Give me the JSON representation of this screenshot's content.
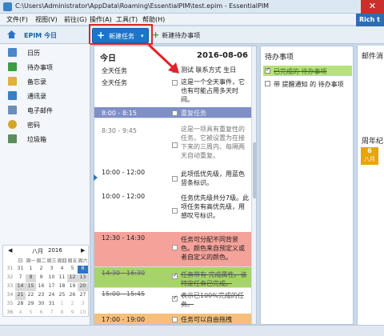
{
  "window": {
    "title": "C:\\Users\\Administrator\\AppData\\Roaming\\EssentialPIM\\test.epim - EssentialPIM",
    "close_symbol": "✕"
  },
  "menu": {
    "items": [
      "文件(F)",
      "视图(V)",
      "前往(G)",
      "操作(A)",
      "工具(T)",
      "帮助(H)"
    ],
    "rich_badge": "Rich t"
  },
  "toolbar": {
    "today_label": "EPIM 今日",
    "new_task_label": "新建任务",
    "new_task_plus": "+",
    "new_task_caret": "▾",
    "new_todo_label": "新建待办事项",
    "new_todo_plus": "+"
  },
  "sidebar": {
    "items": [
      {
        "label": "日历",
        "icon": "calendar-icon",
        "color": "#4a86c6"
      },
      {
        "label": "待办事项",
        "icon": "todo-icon",
        "color": "#3f9d3f"
      },
      {
        "label": "备忘录",
        "icon": "note-icon",
        "color": "#e0b23a"
      },
      {
        "label": "通讯录",
        "icon": "contacts-icon",
        "color": "#3b7fc3"
      },
      {
        "label": "电子邮件",
        "icon": "mail-icon",
        "color": "#6a8fb8"
      },
      {
        "label": "密码",
        "icon": "key-icon",
        "color": "#d4a52a"
      },
      {
        "label": "垃圾箱",
        "icon": "trash-icon",
        "color": "#5c8d5c"
      }
    ]
  },
  "minical": {
    "month": "八月",
    "year": "2016",
    "prev": "◀",
    "next": "▶",
    "weekdays": [
      "",
      "日",
      "周一",
      "周二",
      "周三",
      "周四",
      "周五",
      "周六"
    ],
    "weeks": [
      [
        "31",
        "31",
        "1",
        "2",
        "3",
        "4",
        "5",
        "6"
      ],
      [
        "32",
        "7",
        "8",
        "9",
        "10",
        "11",
        "12",
        "13"
      ],
      [
        "33",
        "14",
        "15",
        "16",
        "17",
        "18",
        "19",
        "20"
      ],
      [
        "34",
        "21",
        "22",
        "23",
        "24",
        "25",
        "26",
        "27"
      ],
      [
        "35",
        "28",
        "29",
        "30",
        "31",
        "1",
        "2",
        "3"
      ],
      [
        "36",
        "4",
        "5",
        "6",
        "7",
        "8",
        "9",
        "10"
      ]
    ]
  },
  "day_view": {
    "title": "今日",
    "date": "2016-08-06",
    "events": [
      {
        "time": "全天任务",
        "desc": "测试 联系方式 生日",
        "bg": "#ffffff",
        "checked": false
      },
      {
        "time": "全天任务",
        "desc": "这是一个全天事件，它也有可能占用多天时间。",
        "bg": "#ffffff",
        "checked": false
      },
      {
        "time": "8:00 - 8:15",
        "desc": "重复任务",
        "bg": "#7f8fc8",
        "checked": false
      },
      {
        "time": "8:30 - 9:45",
        "desc": "这是一项具有重复性的任务。它被设置为在接下来的三周内、每隔两天自动重复。",
        "bg": "#ffffff",
        "checked": false
      },
      {
        "time": "10:00 - 12:00",
        "desc": "此项低优先级，用蓝色竖条标识。",
        "bg": "#ffffff",
        "checked": false
      },
      {
        "time": "10:00 - 12:00",
        "desc": "任务优先级共分7级。此项任务有高优先级，用感叹号标识。",
        "bg": "#ffffff",
        "checked": false
      },
      {
        "time": "12:30 - 14:30",
        "desc": "任务可分配不同背景色。颜色来自预定义或者自定义的颜色。",
        "bg": "#f5a29a",
        "checked": false
      },
      {
        "time": "14:30 - 16:30",
        "desc": "任务带有 完成属性。该特定任务已完成。",
        "bg": "#a6d46a",
        "checked": true
      },
      {
        "time": "15:00 - 15:45",
        "desc": "表示已100%完成的任务。",
        "bg": "#ffffff",
        "checked": true
      },
      {
        "time": "17:00 - 19:00",
        "desc": "任务可以自由拖拽",
        "bg": "#f6c07a",
        "checked": false
      }
    ]
  },
  "todo_panel": {
    "title": "待办事项",
    "items": [
      {
        "label": "已完成的 待办事项",
        "checked": true,
        "bg": "#b7e17c",
        "strike": true
      },
      {
        "label": "带 提醒通知 的 待办事项",
        "checked": false,
        "bg": "#ffffff",
        "strike": false
      }
    ]
  },
  "mail_panel": {
    "title": "邮件消",
    "week_title": "周年纪",
    "badge_day": "6",
    "badge_month": "八月",
    "badge_color": "#e8a40b"
  }
}
